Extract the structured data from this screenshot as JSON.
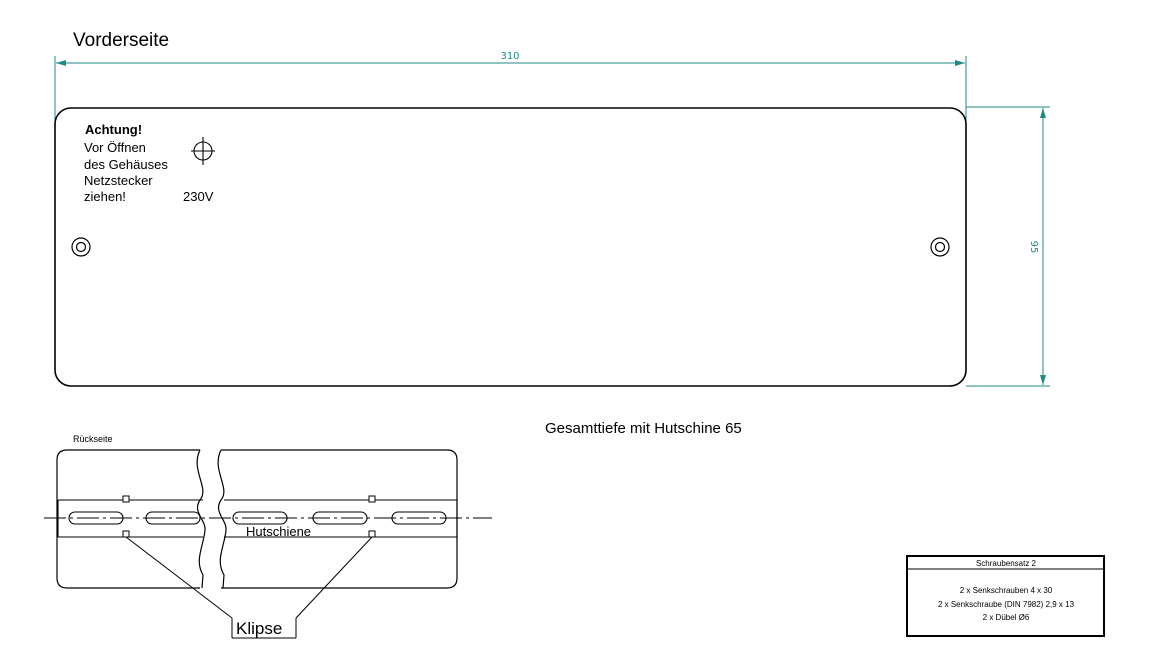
{
  "front": {
    "title": "Vorderseite",
    "width_dim": "310",
    "height_dim": "95",
    "warning": {
      "heading": "Achtung!",
      "line1": "Vor Öffnen",
      "line2": "des Gehäuses",
      "line3": "Netzstecker",
      "line4": "ziehen!",
      "voltage": "230V"
    }
  },
  "back": {
    "title": "Rückseite",
    "rail_label": "Hutschiene",
    "clips_label": "Klipse"
  },
  "depth_note": "Gesamttiefe mit Hutschine 65",
  "screw_set": {
    "title": "Schraubensatz 2",
    "items": [
      "2 x  Senkschrauben 4 x 30",
      "2 x Senkschraube (DIN 7982) 2,9 x 13",
      "2 x Dübel Ø6"
    ]
  },
  "colors": {
    "line": "#000000",
    "dimension": "#1f8a86"
  }
}
